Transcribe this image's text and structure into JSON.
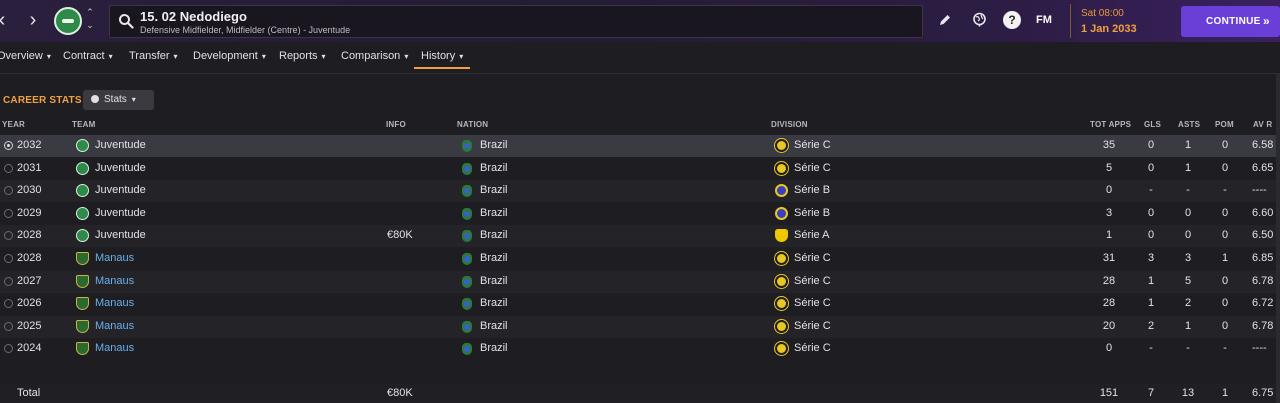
{
  "header": {
    "player_name": "15. 02 Nedodiego",
    "player_subtitle": "Defensive Midfielder, Midfielder (Centre) - Juventude",
    "fm_logo": "FM",
    "time": "Sat 08:00",
    "date": "1 Jan 2033",
    "continue_label": "CONTINUE",
    "continue_chevron": "»",
    "back_glyph": "‹",
    "forward_glyph": "›",
    "up_glyph": "⌃",
    "down_glyph": "⌄",
    "help_glyph": "?"
  },
  "tabs": [
    {
      "label": "Overview"
    },
    {
      "label": "Contract"
    },
    {
      "label": "Transfer"
    },
    {
      "label": "Development"
    },
    {
      "label": "Reports"
    },
    {
      "label": "Comparison"
    },
    {
      "label": "History",
      "active": true
    }
  ],
  "section": {
    "title": "CAREER STATS",
    "stats_button": "Stats"
  },
  "columns": {
    "year": "YEAR",
    "team": "TEAM",
    "info": "INFO",
    "nation": "NATION",
    "division": "DIVISION",
    "tot_apps": "TOT APPS",
    "gls": "GLS",
    "asts": "ASTS",
    "pom": "POM",
    "av_r": "AV R"
  },
  "rows": [
    {
      "year": "2032",
      "team": "Juventude",
      "club": "juventude",
      "info": "",
      "nation": "Brazil",
      "division": "Série C",
      "div_level": "c",
      "apps": "35",
      "gls": "0",
      "asts": "1",
      "pom": "0",
      "avr": "6.58"
    },
    {
      "year": "2031",
      "team": "Juventude",
      "club": "juventude",
      "info": "",
      "nation": "Brazil",
      "division": "Série C",
      "div_level": "c",
      "apps": "5",
      "gls": "0",
      "asts": "1",
      "pom": "0",
      "avr": "6.65"
    },
    {
      "year": "2030",
      "team": "Juventude",
      "club": "juventude",
      "info": "",
      "nation": "Brazil",
      "division": "Série B",
      "div_level": "b",
      "apps": "0",
      "gls": "-",
      "asts": "-",
      "pom": "-",
      "avr": "----"
    },
    {
      "year": "2029",
      "team": "Juventude",
      "club": "juventude",
      "info": "",
      "nation": "Brazil",
      "division": "Série B",
      "div_level": "b",
      "apps": "3",
      "gls": "0",
      "asts": "0",
      "pom": "0",
      "avr": "6.60"
    },
    {
      "year": "2028",
      "team": "Juventude",
      "club": "juventude",
      "info": "€80K",
      "nation": "Brazil",
      "division": "Série A",
      "div_level": "a",
      "apps": "1",
      "gls": "0",
      "asts": "0",
      "pom": "0",
      "avr": "6.50"
    },
    {
      "year": "2028",
      "team": "Manaus",
      "club": "manaus",
      "info": "",
      "nation": "Brazil",
      "division": "Série C",
      "div_level": "c",
      "apps": "31",
      "gls": "3",
      "asts": "3",
      "pom": "1",
      "avr": "6.85"
    },
    {
      "year": "2027",
      "team": "Manaus",
      "club": "manaus",
      "info": "",
      "nation": "Brazil",
      "division": "Série C",
      "div_level": "c",
      "apps": "28",
      "gls": "1",
      "asts": "5",
      "pom": "0",
      "avr": "6.78"
    },
    {
      "year": "2026",
      "team": "Manaus",
      "club": "manaus",
      "info": "",
      "nation": "Brazil",
      "division": "Série C",
      "div_level": "c",
      "apps": "28",
      "gls": "1",
      "asts": "2",
      "pom": "0",
      "avr": "6.72"
    },
    {
      "year": "2025",
      "team": "Manaus",
      "club": "manaus",
      "info": "",
      "nation": "Brazil",
      "division": "Série C",
      "div_level": "c",
      "apps": "20",
      "gls": "2",
      "asts": "1",
      "pom": "0",
      "avr": "6.78"
    },
    {
      "year": "2024",
      "team": "Manaus",
      "club": "manaus",
      "info": "",
      "nation": "Brazil",
      "division": "Série C",
      "div_level": "c",
      "apps": "0",
      "gls": "-",
      "asts": "-",
      "pom": "-",
      "avr": "----"
    }
  ],
  "total": {
    "label": "Total",
    "info": "€80K",
    "apps": "151",
    "gls": "7",
    "asts": "13",
    "pom": "1",
    "avr": "6.75"
  },
  "colors": {
    "accent_orange": "#f0a040",
    "continue_purple": "#6a3fd8",
    "link_blue": "#6aaee8"
  }
}
